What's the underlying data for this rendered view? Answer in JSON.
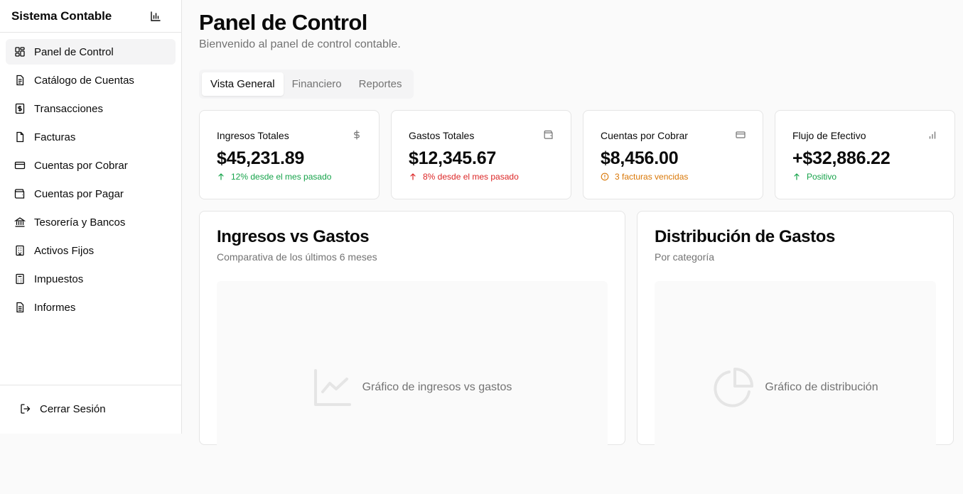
{
  "app": {
    "title": "Sistema Contable",
    "header_icon": "bar-chart-icon"
  },
  "sidebar": {
    "items": [
      {
        "label": "Panel de Control",
        "icon": "dashboard-icon",
        "active": true
      },
      {
        "label": "Catálogo de Cuentas",
        "icon": "document-list-icon",
        "active": false
      },
      {
        "label": "Transacciones",
        "icon": "dollar-square-icon",
        "active": false
      },
      {
        "label": "Facturas",
        "icon": "file-icon",
        "active": false
      },
      {
        "label": "Cuentas por Cobrar",
        "icon": "credit-card-icon",
        "active": false
      },
      {
        "label": "Cuentas por Pagar",
        "icon": "wallet-icon",
        "active": false
      },
      {
        "label": "Tesorería y Bancos",
        "icon": "bank-icon",
        "active": false
      },
      {
        "label": "Activos Fijos",
        "icon": "building-icon",
        "active": false
      },
      {
        "label": "Impuestos",
        "icon": "calculator-icon",
        "active": false
      },
      {
        "label": "Informes",
        "icon": "report-icon",
        "active": false
      }
    ],
    "logout_label": "Cerrar Sesión"
  },
  "header": {
    "title": "Panel de Control",
    "subtitle": "Bienvenido al panel de control contable."
  },
  "tabs": [
    {
      "label": "Vista General",
      "active": true
    },
    {
      "label": "Financiero",
      "active": false
    },
    {
      "label": "Reportes",
      "active": false
    }
  ],
  "stats": [
    {
      "label": "Ingresos Totales",
      "value": "$45,231.89",
      "note": "12% desde el mes pasado",
      "note_icon": "arrow-up-icon",
      "note_color": "#16a34a",
      "icon": "dollar-icon"
    },
    {
      "label": "Gastos Totales",
      "value": "$12,345.67",
      "note": "8% desde el mes pasado",
      "note_icon": "arrow-up-icon",
      "note_color": "#dc2626",
      "icon": "wallet-icon"
    },
    {
      "label": "Cuentas por Cobrar",
      "value": "$8,456.00",
      "note": "3 facturas vencidas",
      "note_icon": "alert-circle-icon",
      "note_color": "#d97706",
      "icon": "credit-card-icon"
    },
    {
      "label": "Flujo de Efectivo",
      "value": "+$32,886.22",
      "note": "Positivo",
      "note_icon": "arrow-up-icon",
      "note_color": "#16a34a",
      "icon": "bar-chart-icon"
    }
  ],
  "charts": {
    "income_vs_expenses": {
      "title": "Ingresos vs Gastos",
      "subtitle": "Comparativa de los últimos 6 meses",
      "placeholder": "Gráfico de ingresos vs gastos",
      "icon": "line-chart-icon"
    },
    "expense_distribution": {
      "title": "Distribución de Gastos",
      "subtitle": "Por categoría",
      "placeholder": "Gráfico de distribución",
      "icon": "pie-chart-icon"
    }
  },
  "colors": {
    "positive": "#16a34a",
    "negative": "#dc2626",
    "warning": "#d97706",
    "muted": "#737373",
    "border": "#e5e5e5"
  }
}
